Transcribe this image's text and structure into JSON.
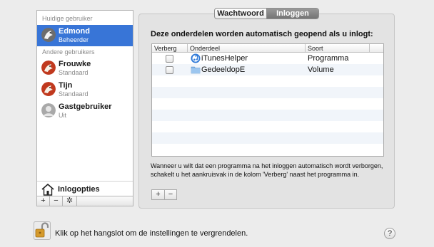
{
  "sidebar": {
    "current_header": "Huidige gebruiker",
    "others_header": "Andere gebruikers",
    "current_user": {
      "name": "Edmond",
      "role": "Beheerder",
      "avatar_icon": "eagle-avatar-icon"
    },
    "other_users": [
      {
        "name": "Frouwke",
        "role": "Standaard",
        "avatar_icon": "red-avatar-icon"
      },
      {
        "name": "Tijn",
        "role": "Standaard",
        "avatar_icon": "red-avatar-icon"
      },
      {
        "name": "Gastgebruiker",
        "role": "Uit",
        "avatar_icon": "guest-avatar-icon"
      }
    ],
    "login_options_label": "Inlogopties",
    "add_label": "+",
    "remove_label": "−",
    "action_label": "✲"
  },
  "tabs": {
    "password": "Wachtwoord",
    "login": "Inloggen",
    "active": "Inloggen"
  },
  "login_items": {
    "heading": "Deze onderdelen worden automatisch geopend als u inlogt:",
    "columns": {
      "hide": "Verberg",
      "item": "Onderdeel",
      "type": "Soort"
    },
    "rows": [
      {
        "hide": false,
        "icon": "itunes-icon",
        "name": "iTunesHelper",
        "type": "Programma"
      },
      {
        "hide": false,
        "icon": "folder-icon",
        "name": "GedeeldopE",
        "type": "Volume"
      }
    ],
    "hint": "Wanneer u wilt dat een programma na het inloggen automatisch wordt verborgen, schakelt u het aankruisvak in de kolom 'Verberg' naast het programma in.",
    "add_label": "+",
    "remove_label": "−"
  },
  "footer": {
    "lock_text": "Klik op het hangslot om de instellingen te vergrendelen.",
    "help_label": "?"
  },
  "colors": {
    "selection": "#3875d7",
    "active_tab": "#7f7f7f",
    "row_alt": "#f1f5fa"
  }
}
